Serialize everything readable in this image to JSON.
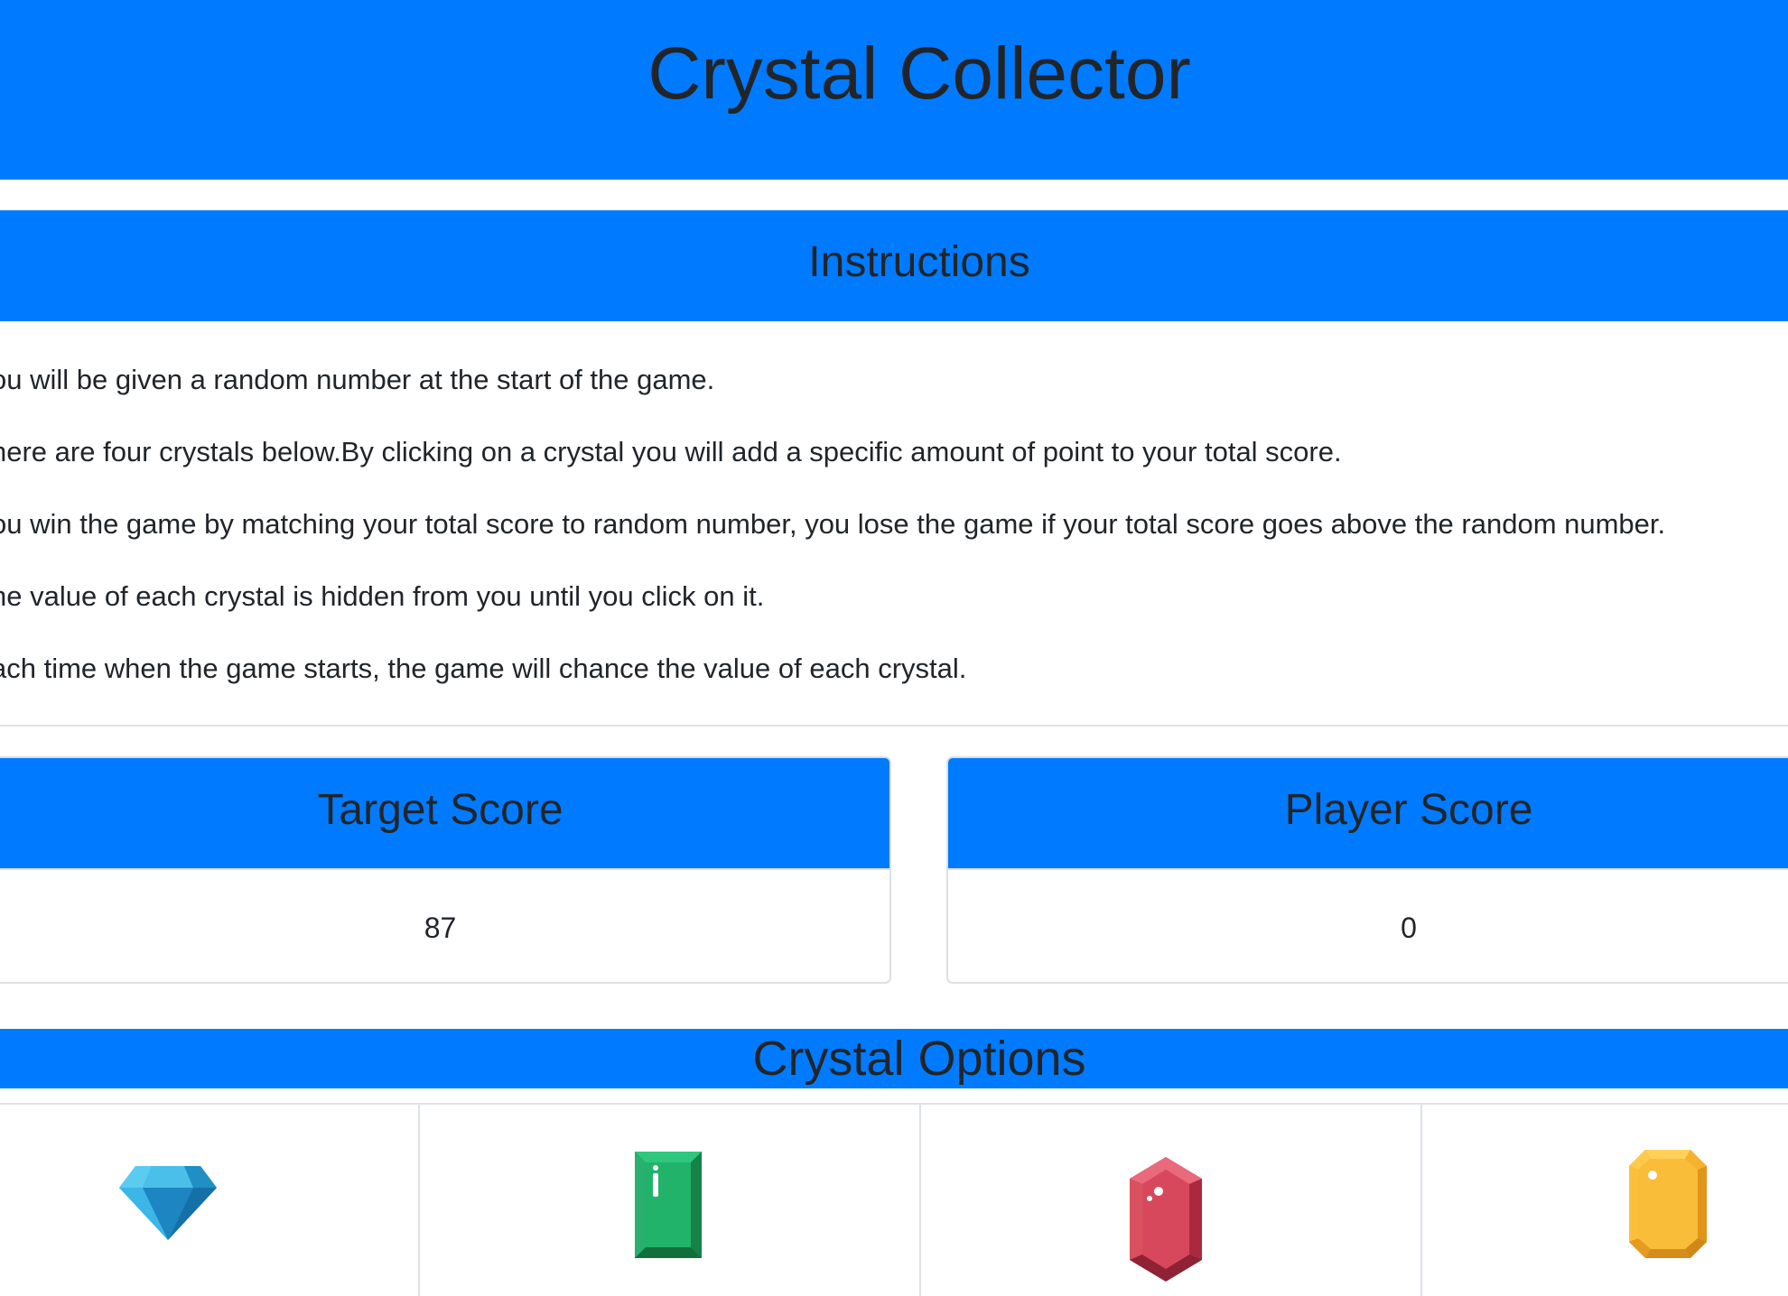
{
  "header": {
    "title": "Crystal Collector"
  },
  "instructions": {
    "heading": "Instructions",
    "items": [
      "ou will be given a random number at the start of the game.",
      "here are four crystals below.By clicking on a crystal you will add a specific amount of point to your total score.",
      "ou win the game by matching your total score to random number, you lose the game if your total score goes above the random number.",
      "he value of each crystal is hidden from you until you click on it.",
      "ach time when the game starts, the game will chance the value of each crystal."
    ]
  },
  "scores": {
    "target_label": "Target Score",
    "target_value": "87",
    "player_label": "Player Score",
    "player_value": "0"
  },
  "crystals": {
    "heading": "Crystal Options",
    "items": [
      {
        "icon": "blue-diamond-icon",
        "color": "#2aa8dd"
      },
      {
        "icon": "green-emerald-icon",
        "color": "#22b36a"
      },
      {
        "icon": "red-ruby-icon",
        "color": "#d8485c"
      },
      {
        "icon": "yellow-topaz-icon",
        "color": "#f9bd3a"
      }
    ]
  },
  "colors": {
    "primary": "#007bff",
    "text": "#212529",
    "border": "#dee2e6"
  }
}
